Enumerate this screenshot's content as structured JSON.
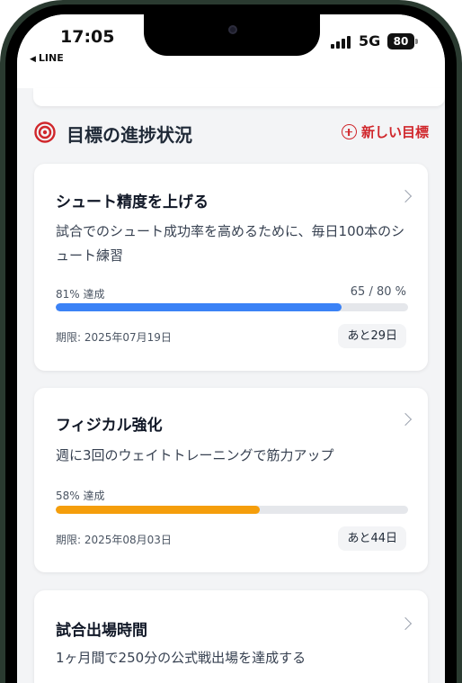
{
  "status_bar": {
    "time": "17:05",
    "back_app": "LINE",
    "network": "5G",
    "battery": "80"
  },
  "section": {
    "title": "目標の進捗状況",
    "new_goal_label": "新しい目標",
    "accent_color": "#d0262b"
  },
  "goals": [
    {
      "title": "シュート精度を上げる",
      "description": "試合でのシュート成功率を高めるために、毎日100本のシュート練習",
      "progress_label": "81% 達成",
      "progress_value": 0.81,
      "progress_count": "65 / 80 %",
      "progress_color": "#3b82f6",
      "deadline": "期限: 2025年07月19日",
      "remaining": "あと29日"
    },
    {
      "title": "フィジカル強化",
      "description": "週に3回のウェイトトレーニングで筋力アップ",
      "progress_label": "58% 達成",
      "progress_value": 0.58,
      "progress_color": "#f59e0b",
      "deadline": "期限: 2025年08月03日",
      "remaining": "あと44日"
    },
    {
      "title": "試合出場時間",
      "description": "1ヶ月間で250分の公式戦出場を達成する"
    }
  ]
}
